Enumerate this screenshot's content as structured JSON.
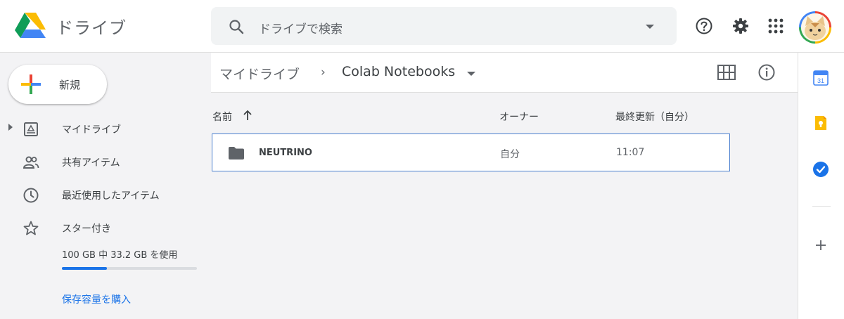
{
  "app": {
    "title": "ドライブ"
  },
  "search": {
    "placeholder": "ドライブで検索"
  },
  "header": {
    "icons": [
      "help-icon",
      "settings-icon",
      "apps-grid-icon",
      "avatar"
    ]
  },
  "sidebar": {
    "new_label": "新規",
    "items": [
      {
        "label": "マイドライブ",
        "icon": "my-drive-icon"
      },
      {
        "label": "共有アイテム",
        "icon": "shared-people-icon"
      },
      {
        "label": "最近使用したアイテム",
        "icon": "clock-icon"
      },
      {
        "label": "スター付き",
        "icon": "star-icon"
      }
    ],
    "storage": {
      "text": "100 GB 中 33.2 GB を使用",
      "used_fraction": 0.332
    },
    "buy_storage": "保存容量を購入"
  },
  "breadcrumb": {
    "root": "マイドライブ",
    "separator": "›",
    "current": "Colab Notebooks"
  },
  "table": {
    "columns": {
      "name": "名前",
      "owner": "オーナー",
      "modified": "最終更新（自分）"
    },
    "rows": [
      {
        "name": "NEUTRINO",
        "owner": "自分",
        "modified": "11:07",
        "icon": "folder-icon"
      }
    ]
  },
  "right_panel": {
    "calendar_day": "31",
    "icons": [
      "calendar-icon",
      "keep-icon",
      "tasks-icon",
      "add-addon-icon"
    ]
  },
  "colors": {
    "accent": "#1a73e8",
    "selection_border": "#4a7fcf",
    "background": "#f3f3f5"
  }
}
